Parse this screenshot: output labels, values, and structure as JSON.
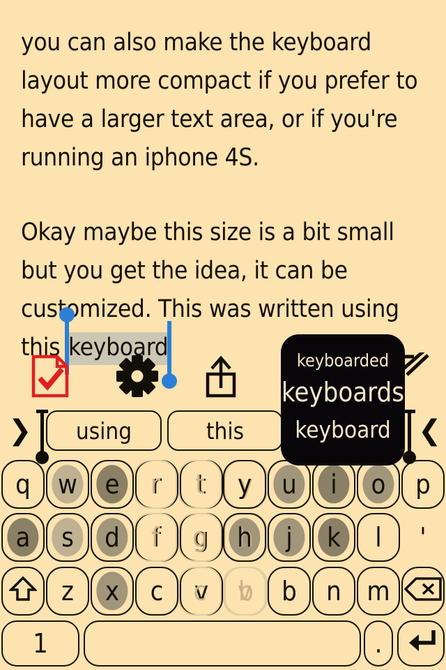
{
  "colors": {
    "background": "#fce3b0",
    "ink": "#141008",
    "selection_highlight": "#cbc7b3",
    "selection_handle": "#2d7fd6",
    "popup_background": "#09060a",
    "popup_text": "#f5e7c8",
    "accent_red": "#e02020",
    "key_heat_light": "#bfb191",
    "key_heat_medium": "#a2967a",
    "key_heat_dark": "#8a8066",
    "key_ghost_border": "#e2cda2"
  },
  "document": {
    "paragraphs": [
      "you can also make the keyboard layout more compact if you prefer to have a larger text area, or if you're running an iphone 4S.",
      "Okay maybe this size is a bit small but you get the idea, it can be customized. This was written using this "
    ],
    "selected_word": "keyboard"
  },
  "toolbar": {
    "items": [
      {
        "name": "document-check-icon",
        "label": "Document with checkmark"
      },
      {
        "name": "gear-icon",
        "label": "Settings"
      },
      {
        "name": "share-icon",
        "label": "Share"
      },
      {
        "name": "edit-pencil-icon",
        "label": "Edit"
      }
    ]
  },
  "prediction_bar": {
    "left_chevron": "❯",
    "right_chevron": "❮",
    "suggestions": [
      "using",
      "this"
    ]
  },
  "autocomplete_popup": {
    "options": [
      "keyboarded",
      "keyboards",
      "keyboard"
    ],
    "selected": "keyboards"
  },
  "keyboard": {
    "rows": [
      {
        "left": [
          {
            "label": "q",
            "heat": 0,
            "ghost": false
          },
          {
            "label": "w",
            "heat": 1,
            "ghost": false
          },
          {
            "label": "e",
            "heat": 3,
            "ghost": false
          },
          {
            "label": "r",
            "heat": 0,
            "ghost": false
          },
          {
            "label": "t",
            "heat": 0,
            "ghost": false
          },
          {
            "label": "y",
            "heat": 0,
            "ghost": true
          }
        ],
        "right": [
          {
            "label": "r",
            "heat": 0,
            "ghost": true
          },
          {
            "label": "t",
            "heat": 0,
            "ghost": true
          },
          {
            "label": "y",
            "heat": 0,
            "ghost": false
          },
          {
            "label": "u",
            "heat": 2,
            "ghost": false
          },
          {
            "label": "i",
            "heat": 3,
            "ghost": false
          },
          {
            "label": "o",
            "heat": 2,
            "ghost": false
          },
          {
            "label": "p",
            "heat": 0,
            "ghost": false
          }
        ]
      },
      {
        "left": [
          {
            "label": "a",
            "heat": 3,
            "ghost": false
          },
          {
            "label": "s",
            "heat": 1,
            "ghost": false
          },
          {
            "label": "d",
            "heat": 2,
            "ghost": false
          },
          {
            "label": "f",
            "heat": 0,
            "ghost": false
          },
          {
            "label": "g",
            "heat": 0,
            "ghost": false
          },
          {
            "label": "h",
            "heat": 0,
            "ghost": true
          }
        ],
        "right": [
          {
            "label": "f",
            "heat": 0,
            "ghost": true
          },
          {
            "label": "g",
            "heat": 0,
            "ghost": true
          },
          {
            "label": "h",
            "heat": 2,
            "ghost": false
          },
          {
            "label": "j",
            "heat": 2,
            "ghost": false
          },
          {
            "label": "k",
            "heat": 3,
            "ghost": false
          },
          {
            "label": "l",
            "heat": 0,
            "ghost": false
          },
          {
            "label": "'",
            "heat": 0,
            "ghost": false,
            "borderless": true
          }
        ]
      },
      {
        "left": [
          {
            "label": "shift-icon",
            "heat": 0,
            "ghost": false,
            "icon": "shift"
          },
          {
            "label": "z",
            "heat": 0,
            "ghost": false
          },
          {
            "label": "x",
            "heat": 2,
            "ghost": false
          },
          {
            "label": "c",
            "heat": 0,
            "ghost": false
          },
          {
            "label": "v",
            "heat": 0,
            "ghost": false
          },
          {
            "label": "b",
            "heat": 0,
            "ghost": true
          }
        ],
        "right": [
          {
            "label": "c",
            "heat": 0,
            "ghost": true
          },
          {
            "label": "v",
            "heat": 0,
            "ghost": true
          },
          {
            "label": "b",
            "heat": 0,
            "ghost": false
          },
          {
            "label": "n",
            "heat": 0,
            "ghost": false
          },
          {
            "label": "m",
            "heat": 0,
            "ghost": false
          },
          {
            "label": "backspace-icon",
            "heat": 0,
            "ghost": false,
            "icon": "backspace"
          }
        ]
      }
    ],
    "bottom_row": [
      {
        "name": "number-key",
        "label": "1"
      },
      {
        "name": "space-key",
        "label": ""
      },
      {
        "name": "period-key",
        "label": "."
      },
      {
        "name": "return-key",
        "label": "return-icon",
        "icon": "return"
      }
    ]
  }
}
